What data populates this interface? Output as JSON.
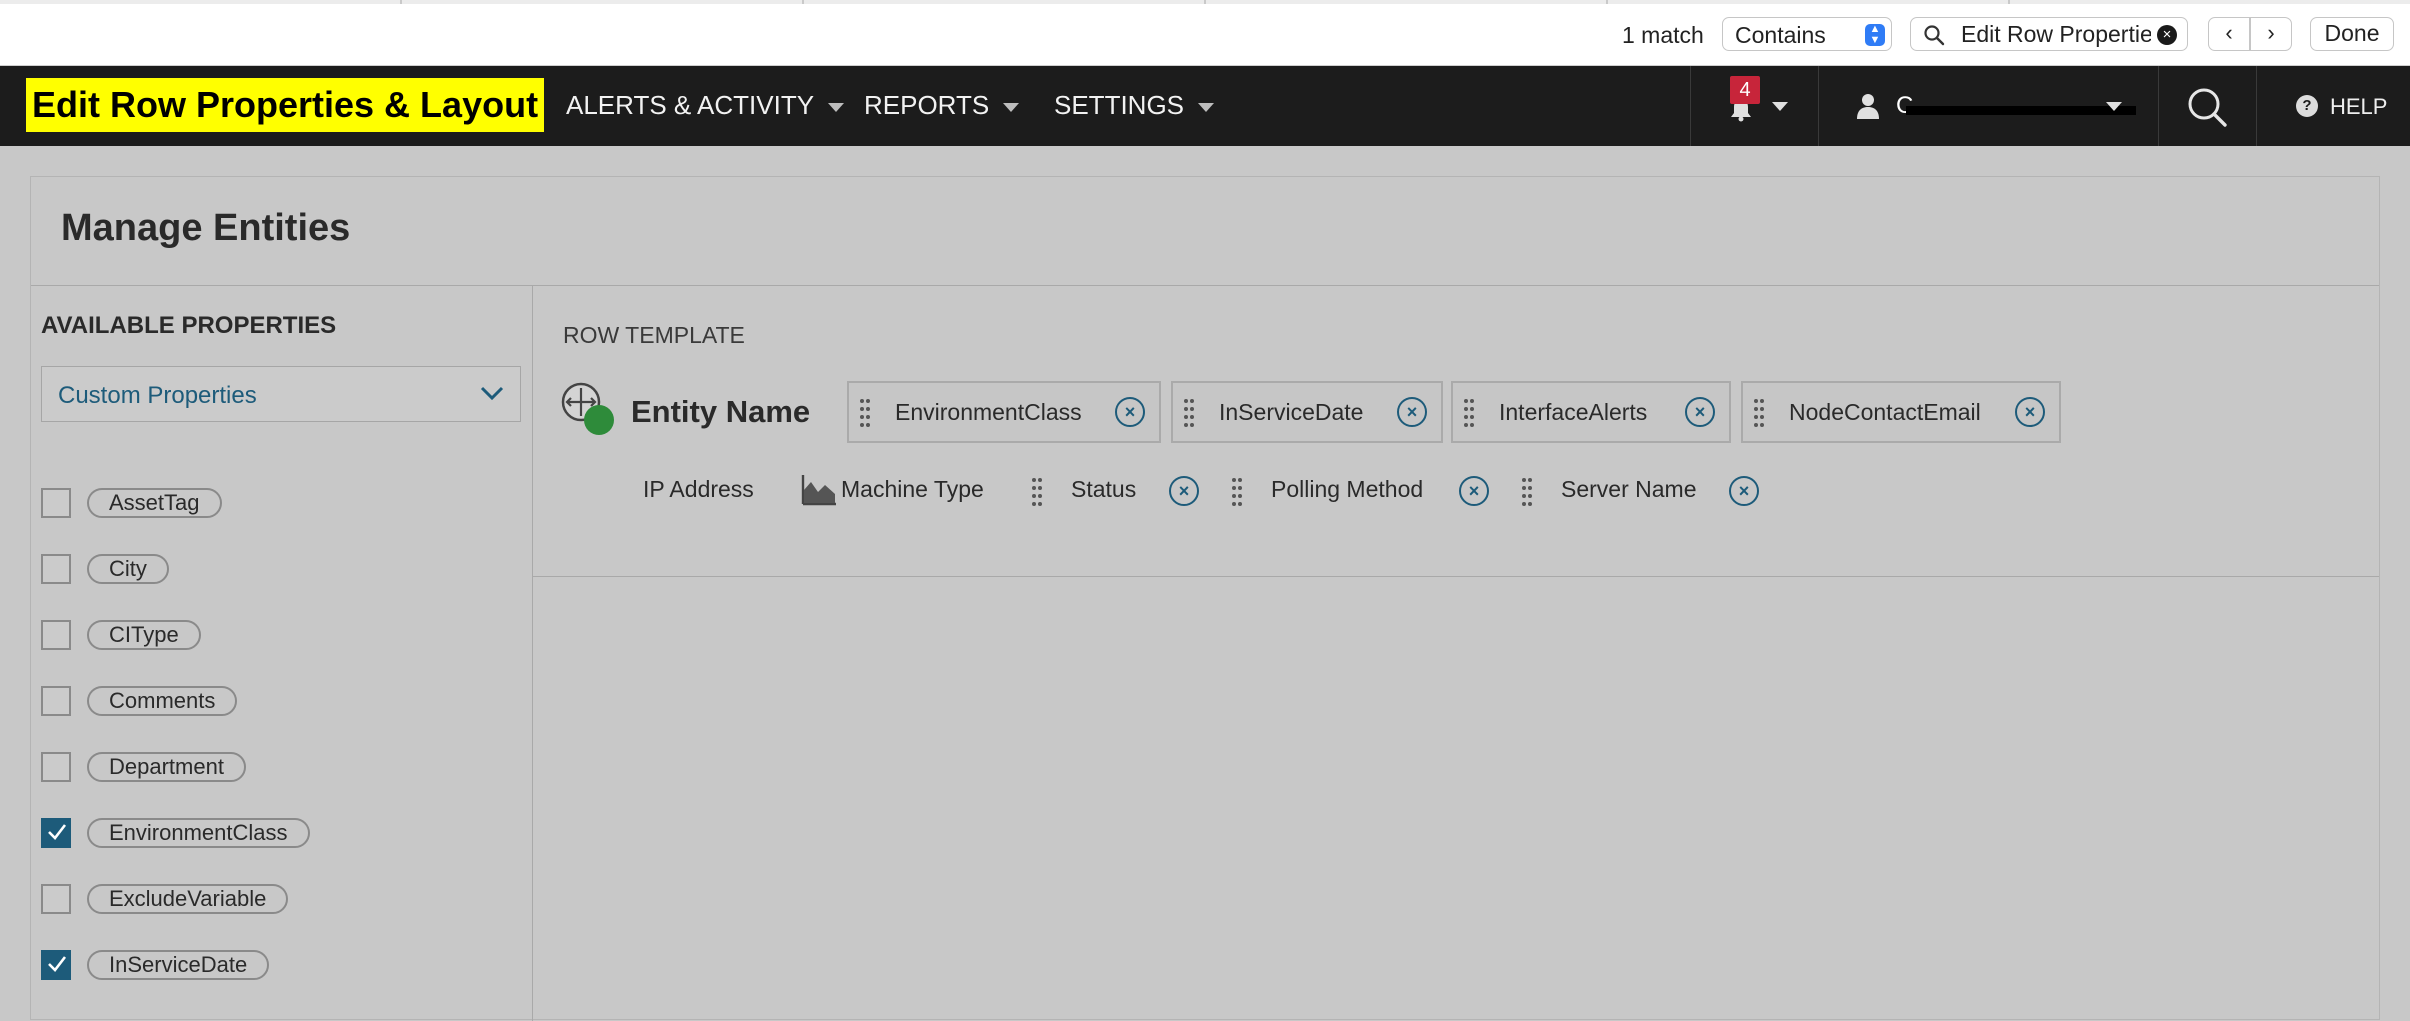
{
  "findbar": {
    "match_count": "1 match",
    "mode_selected": "Contains",
    "search_value": "Edit Row Properties",
    "done_label": "Done",
    "prev_glyph": "‹",
    "next_glyph": "›",
    "clear_glyph": "×"
  },
  "header": {
    "title": "Edit Row Properties & Layout",
    "menu": [
      "ALERTS & ACTIVITY",
      "REPORTS",
      "SETTINGS"
    ],
    "notification_count": "4",
    "user_name_visible": "C",
    "help_label": "HELP",
    "help_glyph": "?"
  },
  "page": {
    "title": "Manage Entities"
  },
  "available": {
    "heading": "AVAILABLE PROPERTIES",
    "dropdown_value": "Custom Properties",
    "properties": [
      {
        "label": "AssetTag",
        "checked": false
      },
      {
        "label": "City",
        "checked": false
      },
      {
        "label": "CIType",
        "checked": false
      },
      {
        "label": "Comments",
        "checked": false
      },
      {
        "label": "Department",
        "checked": false
      },
      {
        "label": "EnvironmentClass",
        "checked": true
      },
      {
        "label": "ExcludeVariable",
        "checked": false
      },
      {
        "label": "InServiceDate",
        "checked": true
      }
    ]
  },
  "template": {
    "heading": "ROW TEMPLATE",
    "entity_name": "Entity Name",
    "row1_chips": [
      "EnvironmentClass",
      "InServiceDate",
      "InterfaceAlerts",
      "NodeContactEmail"
    ],
    "row2_fixed": [
      "IP Address",
      "Machine Type"
    ],
    "row2_chips": [
      "Status",
      "Polling Method",
      "Server Name"
    ],
    "remove_glyph": "×"
  },
  "colors": {
    "accent": "#1d5b7a",
    "highlight": "#ffff00",
    "badge": "#c7253a",
    "header_bg": "#1c1c1c",
    "status_green": "#2e8b3a"
  }
}
